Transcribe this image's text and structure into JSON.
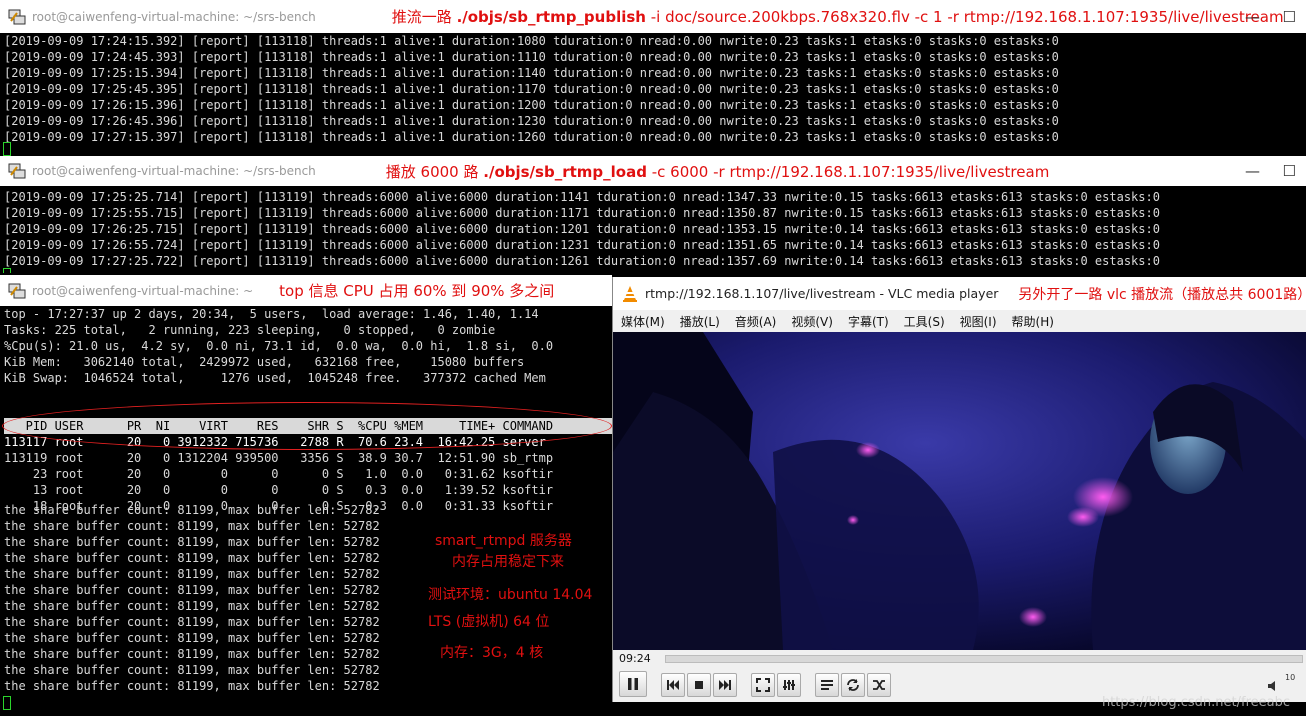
{
  "window1": {
    "title": "root@caiwenfeng-virtual-machine: ~/srs-bench",
    "note_prefix": "推流一路  ",
    "note_cmd": "./objs/sb_rtmp_publish",
    "note_args": " -i doc/source.200kbps.768x320.flv -c 1 -r rtmp://192.168.1.107:1935/live/livestream",
    "minimize": "—",
    "close": "☐",
    "lines": [
      "[2019-09-09 17:24:15.392] [report] [113118] threads:1 alive:1 duration:1080 tduration:0 nread:0.00 nwrite:0.23 tasks:1 etasks:0 stasks:0 estasks:0",
      "[2019-09-09 17:24:45.393] [report] [113118] threads:1 alive:1 duration:1110 tduration:0 nread:0.00 nwrite:0.23 tasks:1 etasks:0 stasks:0 estasks:0",
      "[2019-09-09 17:25:15.394] [report] [113118] threads:1 alive:1 duration:1140 tduration:0 nread:0.00 nwrite:0.23 tasks:1 etasks:0 stasks:0 estasks:0",
      "[2019-09-09 17:25:45.395] [report] [113118] threads:1 alive:1 duration:1170 tduration:0 nread:0.00 nwrite:0.23 tasks:1 etasks:0 stasks:0 estasks:0",
      "[2019-09-09 17:26:15.396] [report] [113118] threads:1 alive:1 duration:1200 tduration:0 nread:0.00 nwrite:0.23 tasks:1 etasks:0 stasks:0 estasks:0",
      "[2019-09-09 17:26:45.396] [report] [113118] threads:1 alive:1 duration:1230 tduration:0 nread:0.00 nwrite:0.23 tasks:1 etasks:0 stasks:0 estasks:0",
      "[2019-09-09 17:27:15.397] [report] [113118] threads:1 alive:1 duration:1260 tduration:0 nread:0.00 nwrite:0.23 tasks:1 etasks:0 stasks:0 estasks:0"
    ]
  },
  "window2": {
    "title": "root@caiwenfeng-virtual-machine: ~/srs-bench",
    "note_prefix": "播放 6000 路 ",
    "note_cmd": "./objs/sb_rtmp_load",
    "note_args": " -c 6000 -r rtmp://192.168.1.107:1935/live/livestream",
    "minimize": "—",
    "close": "☐",
    "lines": [
      "[2019-09-09 17:25:25.714] [report] [113119] threads:6000 alive:6000 duration:1141 tduration:0 nread:1347.33 nwrite:0.15 tasks:6613 etasks:613 stasks:0 estasks:0",
      "[2019-09-09 17:25:55.715] [report] [113119] threads:6000 alive:6000 duration:1171 tduration:0 nread:1350.87 nwrite:0.15 tasks:6613 etasks:613 stasks:0 estasks:0",
      "[2019-09-09 17:26:25.715] [report] [113119] threads:6000 alive:6000 duration:1201 tduration:0 nread:1353.15 nwrite:0.14 tasks:6613 etasks:613 stasks:0 estasks:0",
      "[2019-09-09 17:26:55.724] [report] [113119] threads:6000 alive:6000 duration:1231 tduration:0 nread:1351.65 nwrite:0.14 tasks:6613 etasks:613 stasks:0 estasks:0",
      "[2019-09-09 17:27:25.722] [report] [113119] threads:6000 alive:6000 duration:1261 tduration:0 nread:1357.69 nwrite:0.14 tasks:6613 etasks:613 stasks:0 estasks:0"
    ]
  },
  "window3": {
    "title": "root@caiwenfeng-virtual-machine: ~",
    "note": "top 信息 CPU 占用 60% 到 90% 多之间",
    "top_summary": [
      "top - 17:27:37 up 2 days, 20:34,  5 users,  load average: 1.46, 1.40, 1.14",
      "Tasks: 225 total,   2 running, 223 sleeping,   0 stopped,   0 zombie",
      "%Cpu(s): 21.0 us,  4.2 sy,  0.0 ni, 73.1 id,  0.0 wa,  0.0 hi,  1.8 si,  0.0",
      "KiB Mem:   3062140 total,  2429972 used,   632168 free,    15080 buffers",
      "KiB Swap:  1046524 total,     1276 used,  1045248 free.   377372 cached Mem"
    ],
    "process_header": "   PID USER      PR  NI    VIRT    RES    SHR S  %CPU %MEM     TIME+ COMMAND",
    "processes": [
      "113117 root      20   0 3912332 715736   2788 R  70.6 23.4  16:42.25 server",
      "113119 root      20   0 1312204 939500   3356 S  38.9 30.7  12:51.90 sb_rtmp",
      "    23 root      20   0       0      0      0 S   1.0  0.0   0:31.62 ksoftir",
      "    13 root      20   0       0      0      0 S   0.3  0.0   1:39.52 ksoftir",
      "    18 root      20   0       0      0      0 S   0.3  0.0   0:31.33 ksoftir"
    ],
    "buffer_line": "the share buffer count: 81199, max buffer len: 52782",
    "buffer_lines": [
      "the share buffer count: 81199, max buffer len: 52782",
      "the share buffer count: 81199, max buffer len: 52782",
      "the share buffer count: 81199, max buffer len: 52782",
      "the share buffer count: 81199, max buffer len: 52782",
      "the share buffer count: 81199, max buffer len: 52782",
      "the share buffer count: 81199, max buffer len: 52782",
      "the share buffer count: 81199, max buffer len: 52782",
      "the share buffer count: 81199, max buffer len: 52782",
      "the share buffer count: 81199, max buffer len: 52782",
      "the share buffer count: 81199, max buffer len: 52782",
      "the share buffer count: 81199, max buffer len: 52782",
      "the share buffer count: 81199, max buffer len: 52782"
    ],
    "notes": {
      "server_line1": "smart_rtmpd 服务器",
      "server_line2": "内存占用稳定下来",
      "env_line1": "测试环境：ubuntu 14.04",
      "env_line2": "LTS (虚拟机) 64 位",
      "env_line3": "内存：3G，4 核"
    }
  },
  "vlc": {
    "title": "rtmp://192.168.1.107/live/livestream - VLC media player",
    "note": "另外开了一路 vlc 播放流（播放总共 6001路）",
    "menu": [
      "媒体(M)",
      "播放(L)",
      "音频(A)",
      "视频(V)",
      "字幕(T)",
      "工具(S)",
      "视图(I)",
      "帮助(H)"
    ],
    "time": "09:24",
    "progress": 0.0,
    "controls": {
      "pause": "pause-icon",
      "prev": "previous-icon",
      "stop": "stop-icon",
      "next": "next-icon",
      "fullscreen": "fullscreen-icon",
      "extended": "equalizer-icon",
      "playlist": "playlist-icon",
      "loop": "loop-icon",
      "shuffle": "shuffle-icon"
    },
    "volume": "10"
  },
  "watermark": "https://blog.csdn.net/freeabc",
  "colors": {
    "annotation_red": "#e01010",
    "terminal_text": "#d9d9d9",
    "cursor_green": "#2bd42b"
  }
}
